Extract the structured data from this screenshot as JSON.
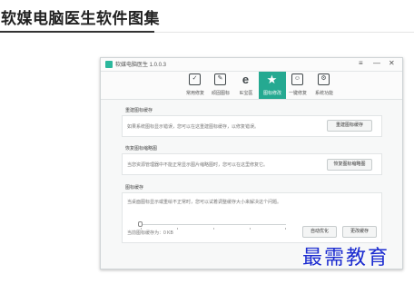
{
  "page": {
    "heading": "软媒电脑医生软件图集"
  },
  "window": {
    "title": "软媒电脑医生 1.0.0.3",
    "controls": {
      "menu": "≡",
      "minimize": "—",
      "close": "✕"
    }
  },
  "toolbar": {
    "items": [
      {
        "label": "常用修复",
        "icon": "wrench-screen-icon",
        "glyph": "✓"
      },
      {
        "label": "顽固图标",
        "icon": "pen-icon",
        "glyph": "✎"
      },
      {
        "label": "IE宝医",
        "icon": "ie-icon",
        "glyph": "e"
      },
      {
        "label": "图标修改",
        "icon": "star-icon",
        "glyph": "★",
        "active": true
      },
      {
        "label": "一键修复",
        "icon": "user-icon",
        "glyph": "☺"
      },
      {
        "label": "系统功能",
        "icon": "gear-screen-icon",
        "glyph": "⚙"
      }
    ]
  },
  "sections": {
    "rebuild": {
      "title": "重建图标缓存",
      "desc": "如果系统图标显示错误，您可以在这重建图标缓存，以修复错误。",
      "button": "重建图标缓存"
    },
    "tray": {
      "title": "恢复图标缩略图",
      "desc": "当您资源管理器中不能正常显示图片缩略图时，您可以在这里修复它。",
      "button": "恢复图标缩略图"
    },
    "cache": {
      "title": "图标缓存",
      "desc": "当桌面图标显示或重绘不正常时，您可以试着调整缓存大小来解决这个问题。",
      "size_text": "当前图标缓存为：0 KB",
      "buttons": {
        "auto": "自动优化",
        "change": "更改缓存"
      }
    }
  },
  "watermark": "最需教育",
  "colors": {
    "accent": "#25a991",
    "watermark": "#1b2bd0"
  }
}
